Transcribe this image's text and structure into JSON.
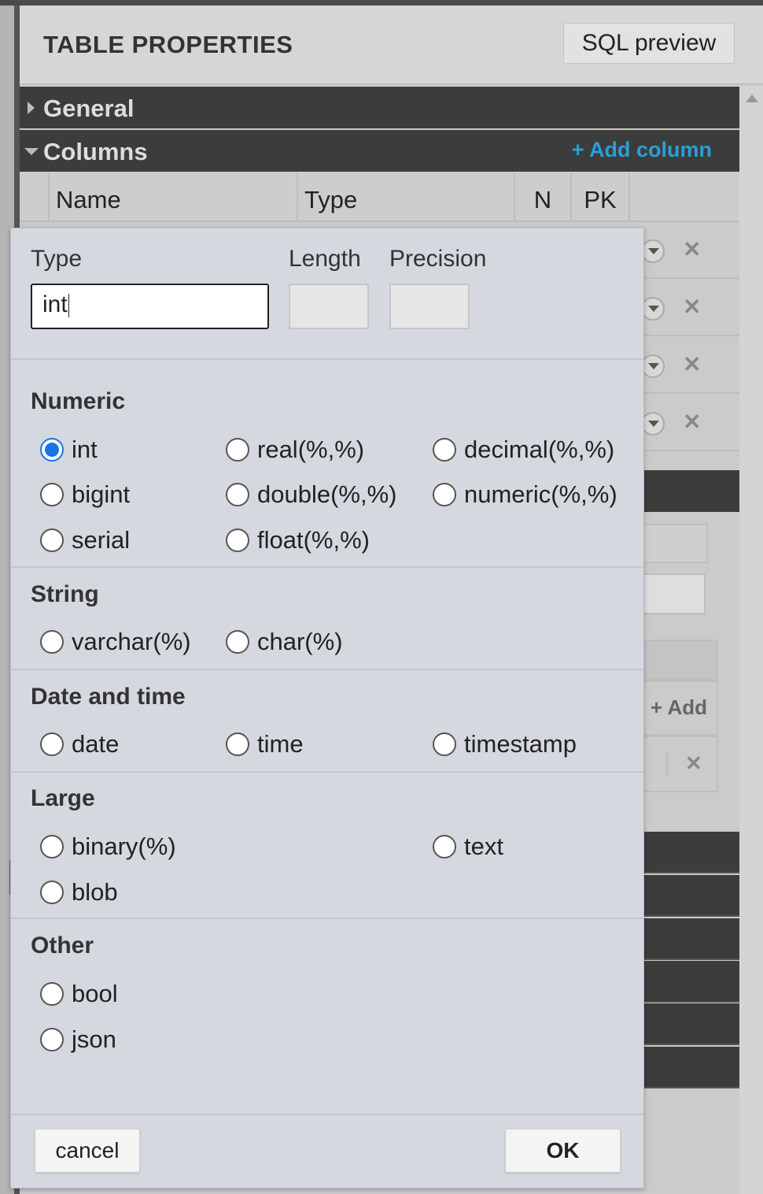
{
  "panel": {
    "title": "TABLE PROPERTIES",
    "sql_preview_label": "SQL preview"
  },
  "sections": {
    "general_label": "General",
    "columns_label": "Columns",
    "add_column_label": "+ Add column"
  },
  "columns_table": {
    "headers": [
      "Name",
      "Type",
      "N",
      "PK"
    ]
  },
  "background": {
    "add_label": "+ Add",
    "remove_glyph": "✕"
  },
  "dialog": {
    "type_label": "Type",
    "length_label": "Length",
    "precision_label": "Precision",
    "type_value": "int",
    "length_value": "",
    "precision_value": "",
    "selected_type": "int",
    "groups": [
      {
        "title": "Numeric",
        "options": [
          "int",
          "real(%,%)",
          "decimal(%,%)",
          "bigint",
          "double(%,%)",
          "numeric(%,%)",
          "serial",
          "float(%,%)"
        ]
      },
      {
        "title": "String",
        "options": [
          "varchar(%)",
          "char(%)"
        ]
      },
      {
        "title": "Date and time",
        "options": [
          "date",
          "time",
          "timestamp"
        ]
      },
      {
        "title": "Large",
        "options": [
          "binary(%)",
          "text",
          "blob"
        ]
      },
      {
        "title": "Other",
        "options": [
          "bool",
          "json"
        ]
      }
    ],
    "cancel_label": "cancel",
    "ok_label": "OK"
  },
  "colors": {
    "accent": "#2a9fd6",
    "radio_checked": "#1a73e8",
    "section_bar": "#3c3c3c"
  }
}
